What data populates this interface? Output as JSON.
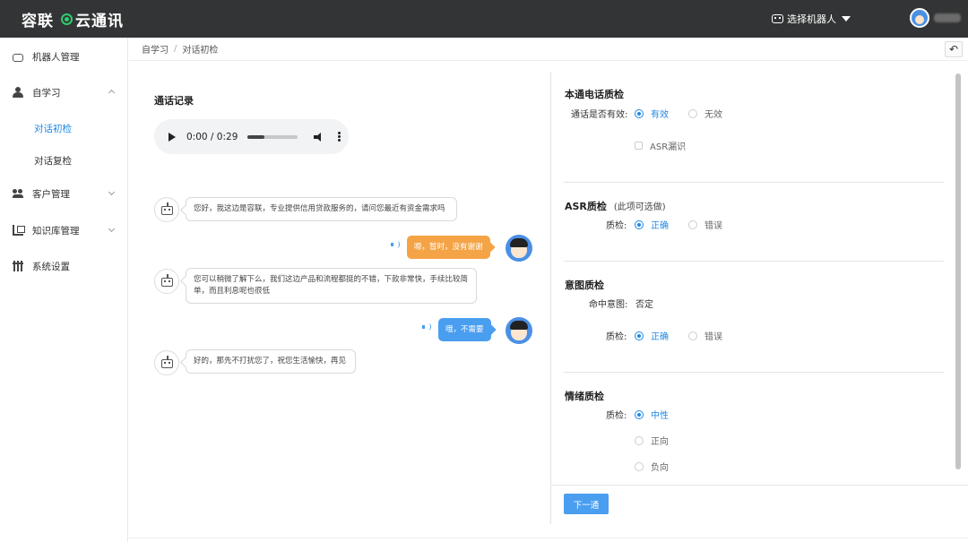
{
  "app": {
    "logo_left": "容联",
    "logo_right": "云通讯"
  },
  "topbar": {
    "robot_select_label": "选择机器人"
  },
  "sidebar": {
    "items": [
      {
        "label": "机器人管理",
        "icon": "robot-icon"
      },
      {
        "label": "自学习",
        "icon": "learn-icon",
        "expanded": true,
        "children": [
          {
            "label": "对话初检",
            "active": true
          },
          {
            "label": "对话复检",
            "active": false
          }
        ]
      },
      {
        "label": "客户管理",
        "icon": "users-icon"
      },
      {
        "label": "知识库管理",
        "icon": "knowledge-base-icon"
      },
      {
        "label": "系统设置",
        "icon": "settings-icon"
      }
    ]
  },
  "breadcrumb": [
    "自学习",
    "对话初检"
  ],
  "call_record": {
    "title": "通话记录",
    "audio": {
      "time": "0:00 / 0:29",
      "progress": 0.34
    }
  },
  "conversation": [
    {
      "speaker": "bot",
      "text": "您好，我这边是容联，专业提供信用贷款服务的，请问您最近有资金需求吗"
    },
    {
      "speaker": "user",
      "text": "嗯，暂时，没有谢谢",
      "color": "#f4a447"
    },
    {
      "speaker": "bot",
      "text": "您可以稍微了解下么，我们这边产品和流程都挺的不错，下款非常快，手续比较简单，而且利息呢也很低"
    },
    {
      "speaker": "user",
      "text": "哦，不需要",
      "color": "#4a9ef0"
    },
    {
      "speaker": "bot",
      "text": "好的，那先不打扰您了，祝您生活愉快，再见"
    }
  ],
  "qc": {
    "call": {
      "title": "本通电话质检",
      "label": "通话是否有效:",
      "options": [
        {
          "label": "有效",
          "selected": true
        },
        {
          "label": "无效",
          "selected": false
        }
      ],
      "checkbox": "ASR漏识"
    },
    "asr": {
      "title": "ASR质检",
      "note": "(此项可选做)",
      "label": "质检:",
      "options": [
        {
          "label": "正确",
          "selected": true
        },
        {
          "label": "错误",
          "selected": false
        }
      ]
    },
    "intent": {
      "title": "意图质检",
      "hit_label": "命中意图:",
      "hit_value": "否定",
      "label": "质检:",
      "options": [
        {
          "label": "正确",
          "selected": true
        },
        {
          "label": "错误",
          "selected": false
        }
      ]
    },
    "emotion": {
      "title": "情绪质检",
      "label": "质检:",
      "options": [
        {
          "label": "中性",
          "selected": true
        },
        {
          "label": "正向",
          "selected": false
        },
        {
          "label": "负向",
          "selected": false
        }
      ]
    },
    "next_button": "下一通"
  },
  "colors": {
    "accent": "#1e88e5",
    "topbar": "#333435",
    "logo_ring": "#2ecc71"
  }
}
